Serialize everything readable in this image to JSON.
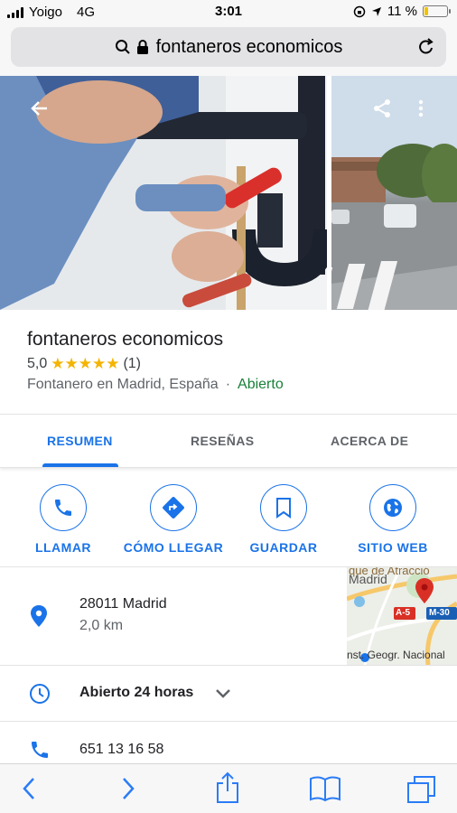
{
  "status_bar": {
    "carrier": "Yoigo",
    "network": "4G",
    "time": "3:01",
    "battery_percent": "11 %",
    "battery_level": 0.11
  },
  "browser": {
    "url_text": "fontaneros economicos",
    "icons": [
      "search-icon",
      "lock-icon",
      "reload-icon"
    ]
  },
  "photos": {
    "main_description_icons": [
      "back-arrow-icon",
      "share-icon",
      "more-vert-icon"
    ]
  },
  "place": {
    "name": "fontaneros economicos",
    "rating": "5,0",
    "stars": "★★★★★",
    "review_count": "(1)",
    "category": "Fontanero en Madrid, España",
    "separator": "·",
    "open_status": "Abierto"
  },
  "tabs": [
    {
      "label": "RESUMEN",
      "active": true
    },
    {
      "label": "RESEÑAS",
      "active": false
    },
    {
      "label": "ACERCA DE",
      "active": false
    }
  ],
  "actions": [
    {
      "label": "LLAMAR",
      "icon": "phone-icon"
    },
    {
      "label": "CÓMO LLEGAR",
      "icon": "directions-icon"
    },
    {
      "label": "GUARDAR",
      "icon": "bookmark-icon"
    },
    {
      "label": "SITIO WEB",
      "icon": "globe-icon"
    }
  ],
  "address": {
    "line1": "28011 Madrid",
    "line2": "2,0 km"
  },
  "map": {
    "label_top": "que de Atracció",
    "label_city": "Madrid",
    "road_a5": "A-5",
    "road_m30": "M-30",
    "label_bottom": "nst. Geogr. Nacional"
  },
  "hours": {
    "text": "Abierto 24 horas"
  },
  "phone": {
    "number": "651 13 16 58"
  },
  "toolbar": {
    "icons": [
      "back-icon",
      "forward-icon",
      "share-icon",
      "bookmarks-icon",
      "tabs-icon"
    ]
  },
  "colors": {
    "accent": "#1a73e8",
    "star": "#f4b400",
    "open": "#188038",
    "ios_blue": "#2b7cf6"
  }
}
